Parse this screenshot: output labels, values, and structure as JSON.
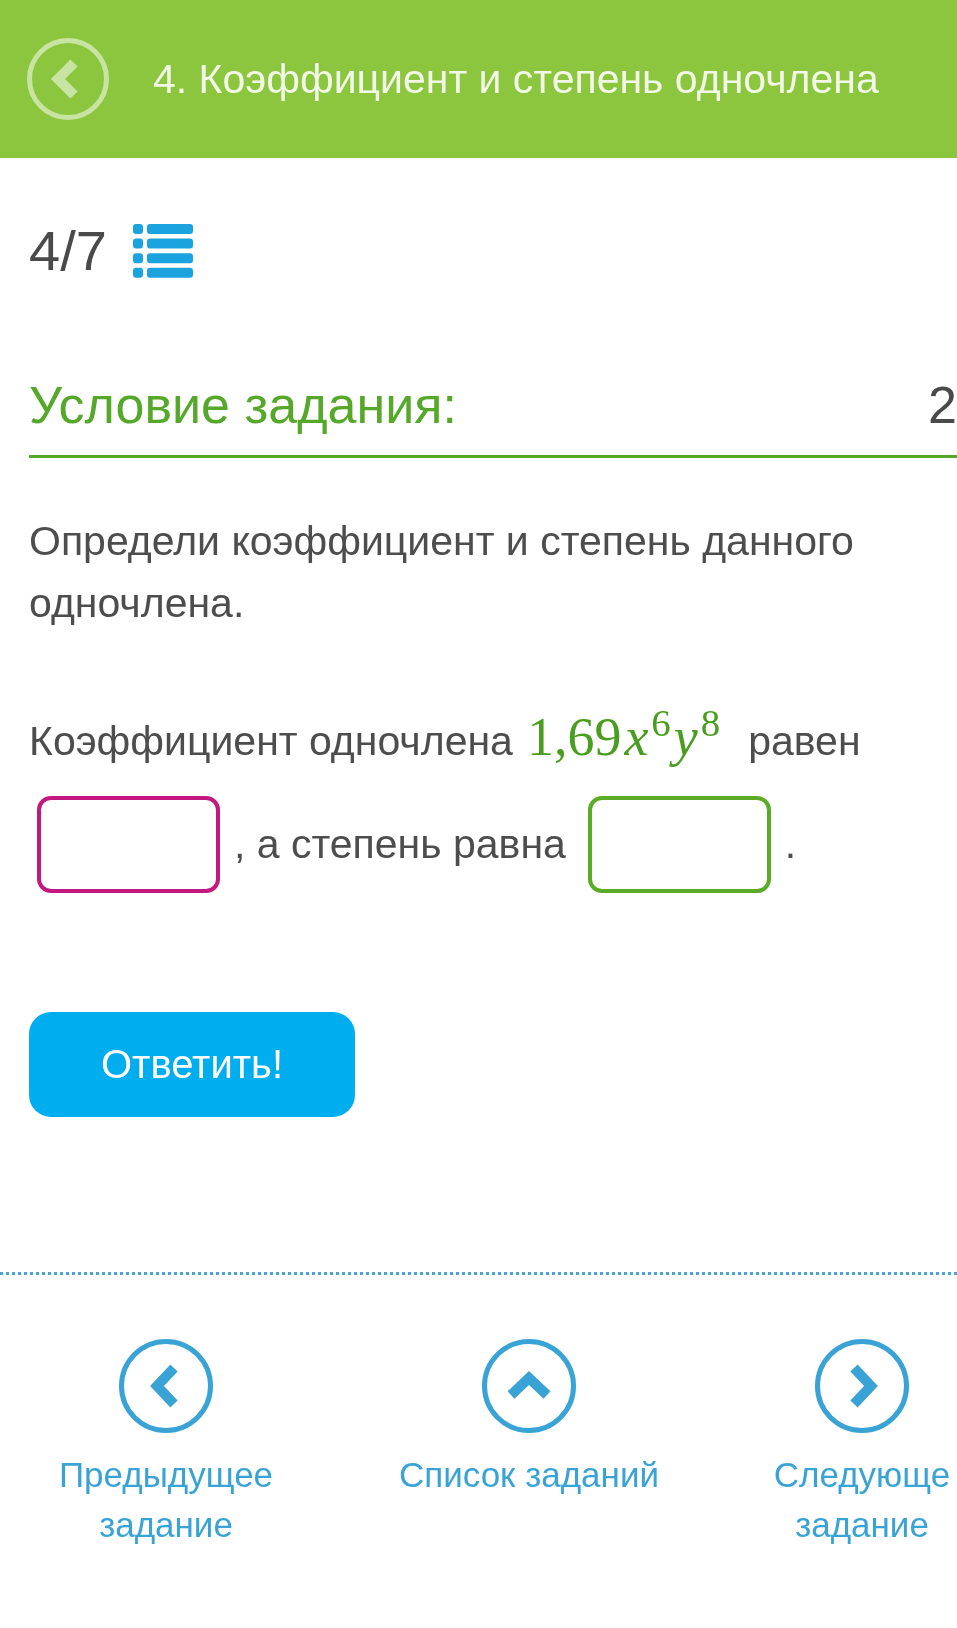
{
  "header": {
    "title": "4. Коэффициент и степень одночлена"
  },
  "progress": {
    "counter": "4/7"
  },
  "condition": {
    "heading": "Условие задания:",
    "side_text": "2"
  },
  "task_text": "Определи коэффициент и степень данного одночлена.",
  "answer_line": [
    {
      "kind": "text",
      "text": "Коэффициент одночлена"
    },
    {
      "kind": "math",
      "coefficient": "1,69",
      "variables": "*x*$^{6}$*y*$^{8}$"
    },
    {
      "kind": "text",
      "text": "равен"
    },
    {
      "kind": "input",
      "color": "#c2187f"
    },
    {
      "kind": "text",
      "text": ", а степень равна"
    },
    {
      "kind": "input",
      "color": "#5aab26"
    },
    {
      "kind": "text",
      "text": "."
    }
  ],
  "submit_button": {
    "label": "Ответить!"
  },
  "nav": [
    {
      "kind": "prev",
      "label": "Предыдущее задание"
    },
    {
      "kind": "list",
      "label": "Список заданий"
    },
    {
      "kind": "next",
      "label": "Следующе задание"
    }
  ]
}
